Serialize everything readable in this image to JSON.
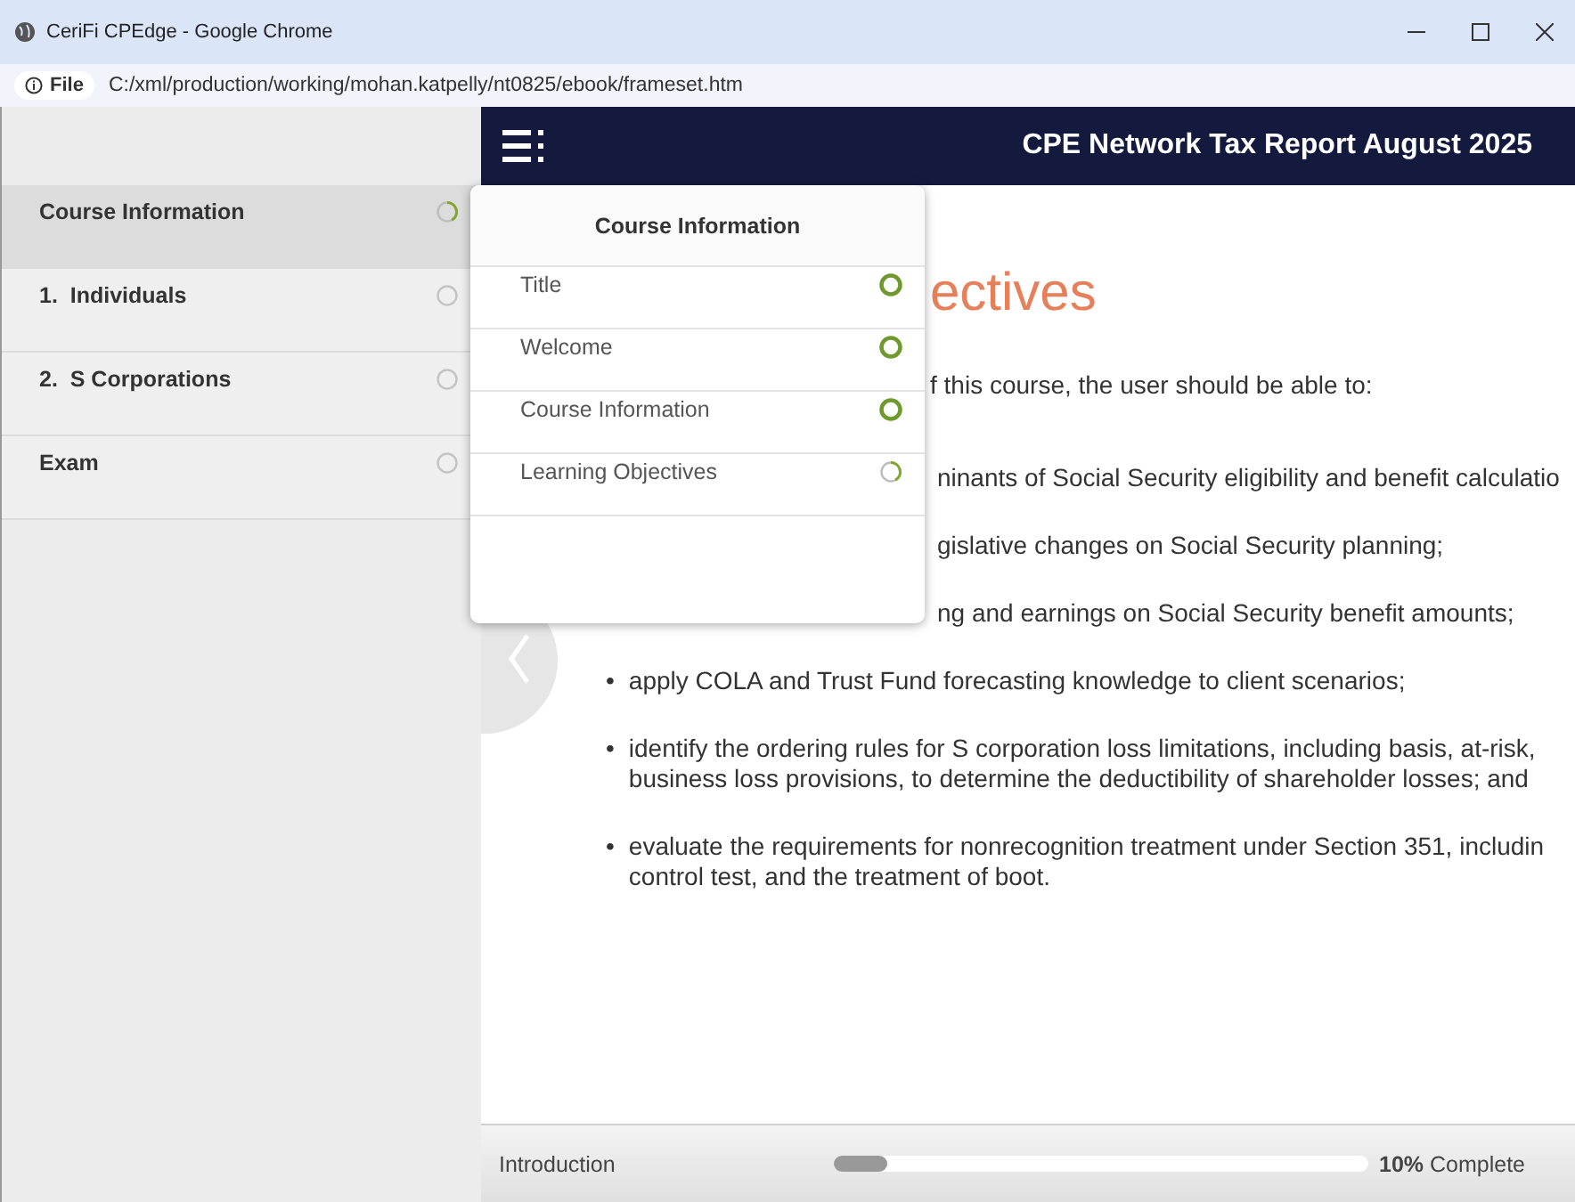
{
  "window": {
    "title": "CeriFi CPEdge - Google Chrome"
  },
  "address_bar": {
    "scheme": "File",
    "url": "C:/xml/production/working/mohan.katpelly/nt0825/ebook/frameset.htm"
  },
  "header": {
    "title": "CPE Network Tax Report August 2025"
  },
  "sidebar": {
    "items": [
      {
        "label": "Course Information",
        "selected": true,
        "kind": "partial"
      },
      {
        "label": "1.  Individuals",
        "selected": false,
        "kind": "empty"
      },
      {
        "label": "2.  S Corporations",
        "selected": false,
        "kind": "empty"
      },
      {
        "label": "Exam",
        "selected": false,
        "kind": "empty"
      }
    ]
  },
  "popup": {
    "title": "Course Information",
    "items": [
      {
        "label": "Title",
        "kind": "complete"
      },
      {
        "label": "Welcome",
        "kind": "complete"
      },
      {
        "label": "Course Information",
        "kind": "complete"
      },
      {
        "label": "Learning Objectives",
        "kind": "partial"
      }
    ]
  },
  "content": {
    "heading": "ectives",
    "intro": "f this course, the user should be able to:",
    "partial_lines": [
      "ninants of Social Security eligibility and benefit calculatio",
      "gislative changes on Social Security planning;",
      "ng and earnings on Social Security benefit amounts;"
    ],
    "bullets": [
      {
        "marker": "•",
        "text": "apply COLA and Trust Fund forecasting knowledge to client scenarios;"
      },
      {
        "marker": "•",
        "text": "identify the ordering rules for S corporation loss limitations, including basis, at-risk,\nbusiness loss provisions, to determine the deductibility of shareholder losses; and"
      },
      {
        "marker": "•",
        "text": "evaluate the requirements for nonrecognition treatment under Section 351, includin\ncontrol test, and the treatment of boot."
      }
    ]
  },
  "footer": {
    "section": "Introduction",
    "progress": {
      "level": 0.1
    },
    "reading": "**10%** Complete"
  }
}
